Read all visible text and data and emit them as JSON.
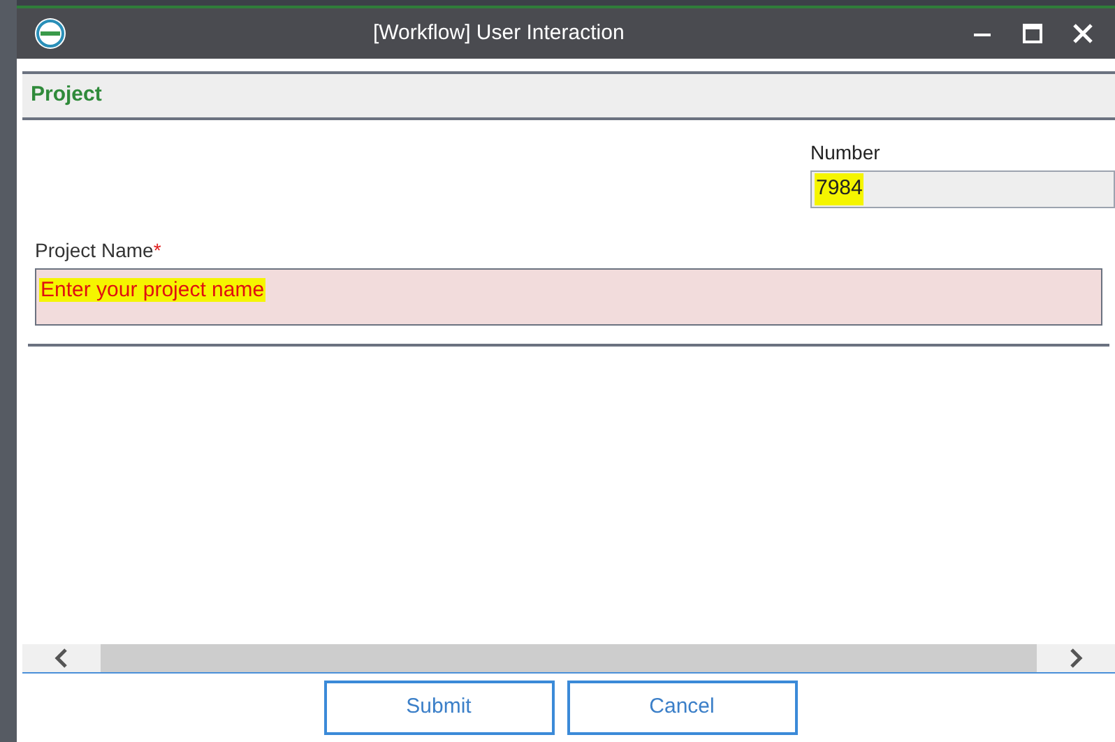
{
  "window": {
    "title": "[Workflow] User Interaction"
  },
  "section": {
    "title": "Project"
  },
  "number": {
    "label": "Number",
    "value": "7984",
    "highlighted": true
  },
  "project_name": {
    "label": "Project Name",
    "required_mark": "*",
    "placeholder": "Enter your project name",
    "invalid": true,
    "highlighted": true
  },
  "buttons": [
    {
      "label": "Submit"
    },
    {
      "label": "Cancel"
    }
  ]
}
